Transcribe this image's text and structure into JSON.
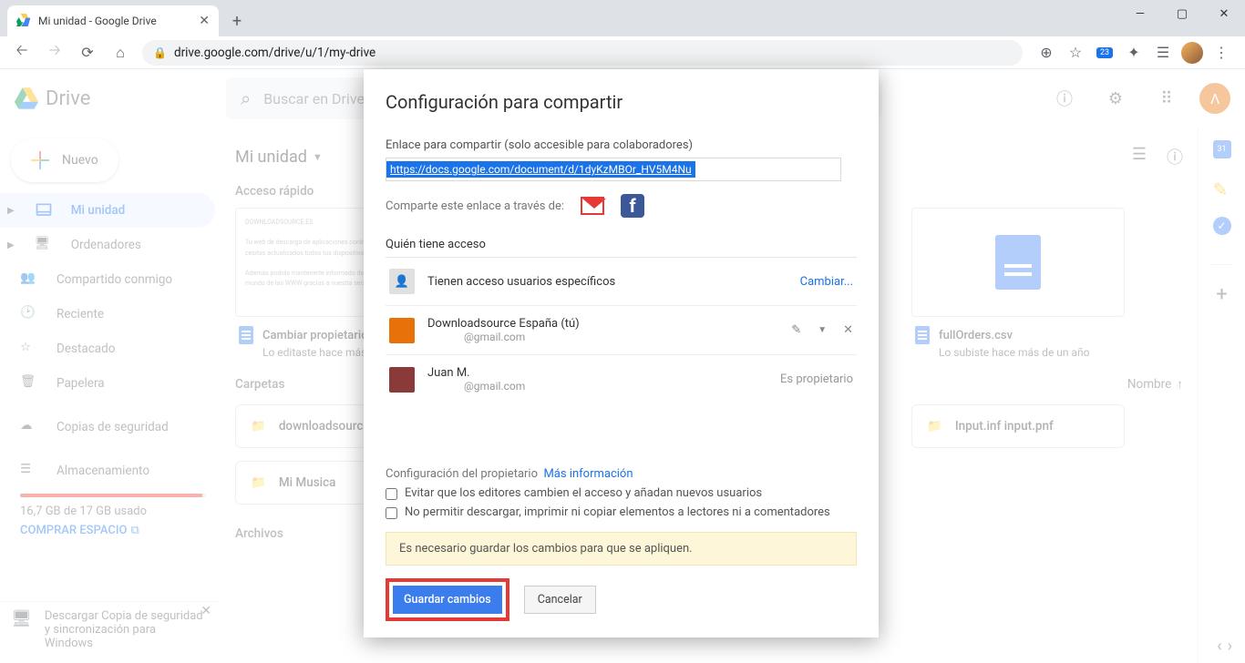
{
  "browser": {
    "tab_title": "Mi unidad - Google Drive",
    "url": "drive.google.com/drive/u/1/my-drive",
    "ext_badge": "23"
  },
  "drive": {
    "app_name": "Drive",
    "search_placeholder": "Buscar en Drive",
    "new_button": "Nuevo",
    "sidebar": {
      "my_drive": "Mi unidad",
      "computers": "Ordenadores",
      "shared": "Compartido conmigo",
      "recent": "Reciente",
      "starred": "Destacado",
      "trash": "Papelera",
      "backups": "Copias de seguridad",
      "storage": "Almacenamiento",
      "storage_used": "16,7 GB de 17 GB usado",
      "buy": "COMPRAR ESPACIO",
      "promo": "Descargar Copia de seguridad y sincronización para Windows"
    },
    "content": {
      "breadcrumb": "Mi unidad",
      "quick_title": "Acceso rápido",
      "quick1_name": "Cambiar propietario",
      "quick1_sub": "Lo editaste hace más de un año",
      "quick2_name": "fullOrders.csv",
      "quick2_sub": "Lo subiste hace más de un año",
      "folders_title": "Carpetas",
      "name_col": "Nombre",
      "folder1": "downloadsource.es",
      "folder2": "Mi Musica",
      "folder3": "Input.inf input.pnf",
      "files_title": "Archivos"
    }
  },
  "modal": {
    "title": "Configuración para compartir",
    "link_label": "Enlace para compartir (solo accesible para colaboradores)",
    "link_value": "https://docs.google.com/document/d/1dyKzMBOr_HV5M4Nu",
    "share_via": "Comparte este enlace a través de:",
    "who_has": "Quién tiene acceso",
    "specific": "Tienen acceso usuarios específicos",
    "change": "Cambiar...",
    "user1_name": "Downloadsource España (tú)",
    "user1_email": "@gmail.com",
    "user2_name": "Juan M.",
    "user2_email": "@gmail.com",
    "owner_role": "Es propietario",
    "owner_cfg": "Configuración del propietario",
    "more_info": "Más información",
    "chk1": "Evitar que los editores cambien el acceso y añadan nuevos usuarios",
    "chk2": "No permitir descargar, imprimir ni copiar elementos a lectores ni a comentadores",
    "warn": "Es necesario guardar los cambios para que se apliquen.",
    "save": "Guardar cambios",
    "cancel": "Cancelar"
  }
}
